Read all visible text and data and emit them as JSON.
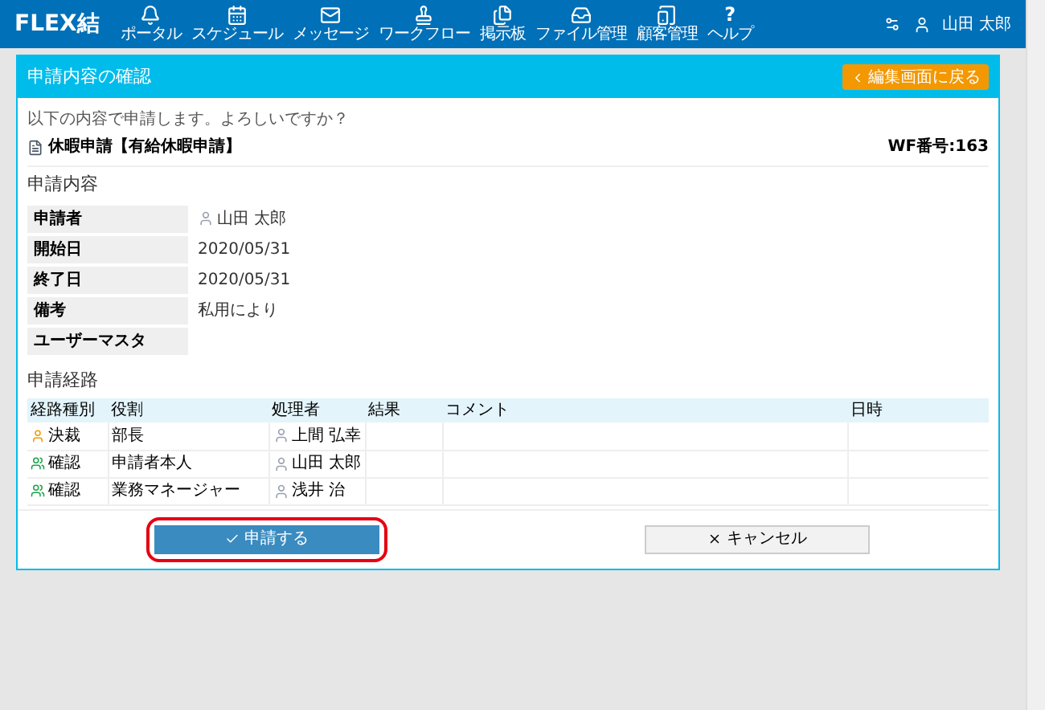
{
  "nav": {
    "logo": "FLEX結",
    "items": [
      {
        "label": "ポータル"
      },
      {
        "label": "スケジュール"
      },
      {
        "label": "メッセージ"
      },
      {
        "label": "ワークフロー"
      },
      {
        "label": "掲示板"
      },
      {
        "label": "ファイル管理"
      },
      {
        "label": "顧客管理"
      },
      {
        "label": "ヘルプ"
      }
    ],
    "help_glyph": "?",
    "user": "山田 太郎"
  },
  "panel": {
    "title": "申請内容の確認",
    "back_button": "編集画面に戻る",
    "prompt": "以下の内容で申請します。よろしいですか？",
    "form_title": "休暇申請【有給休暇申請】",
    "wf_number": "WF番号:163",
    "details_heading": "申請内容",
    "details": [
      {
        "kind": "person",
        "label": "申請者",
        "value": "山田 太郎"
      },
      {
        "kind": "text",
        "label": "開始日",
        "value": "2020/05/31"
      },
      {
        "kind": "text",
        "label": "終了日",
        "value": "2020/05/31"
      },
      {
        "kind": "text",
        "label": "備考",
        "value": "私用により"
      },
      {
        "label": "ユーザーマスタ"
      }
    ],
    "route_heading": "申請経路",
    "route_columns": [
      "経路種別",
      "役割",
      "処理者",
      "結果",
      "コメント",
      "日時"
    ],
    "route_rows": [
      {
        "kind": "approve",
        "type": "決裁",
        "role": "部長",
        "handler": "上間 弘幸"
      },
      {
        "kind": "confirm",
        "type": "確認",
        "role": "申請者本人",
        "handler": "山田 太郎"
      },
      {
        "kind": "confirm",
        "type": "確認",
        "role": "業務マネージャー",
        "handler": "浅井 治"
      }
    ],
    "submit_button": {
      "label": "申請する",
      "highlighted": true
    },
    "cancel_button": "キャンセル"
  }
}
